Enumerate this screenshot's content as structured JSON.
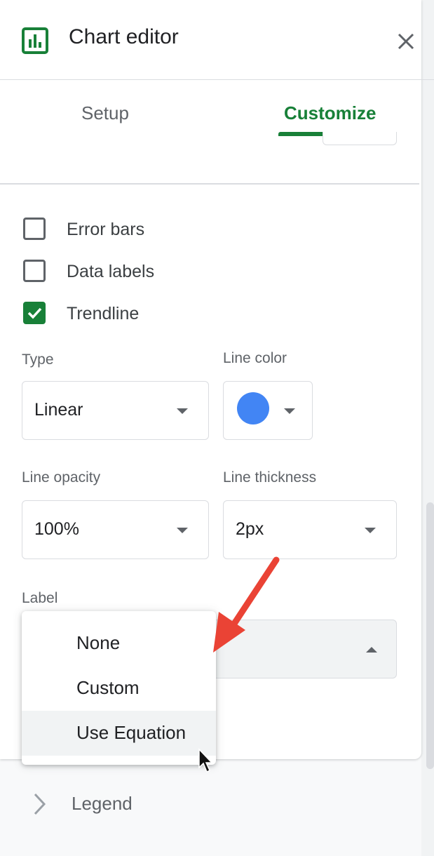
{
  "header": {
    "title": "Chart editor"
  },
  "tabs": [
    {
      "label": "Setup",
      "active": false
    },
    {
      "label": "Customize",
      "active": true
    }
  ],
  "checkboxes": [
    {
      "label": "Error bars",
      "checked": false
    },
    {
      "label": "Data labels",
      "checked": false
    },
    {
      "label": "Trendline",
      "checked": true
    }
  ],
  "trendline": {
    "type": {
      "label": "Type",
      "value": "Linear"
    },
    "line_color": {
      "label": "Line color",
      "value": "#4285f4"
    },
    "line_opacity": {
      "label": "Line opacity",
      "value": "100%"
    },
    "line_thickness": {
      "label": "Line thickness",
      "value": "2px"
    },
    "label": {
      "label": "Label",
      "value": ""
    }
  },
  "label_dropdown": {
    "options": [
      "None",
      "Custom",
      "Use Equation"
    ],
    "highlighted": "Use Equation"
  },
  "sections": {
    "legend": "Legend"
  },
  "colors": {
    "accent": "#188038",
    "arrow": "#ea4335",
    "line_color": "#4285f4"
  }
}
